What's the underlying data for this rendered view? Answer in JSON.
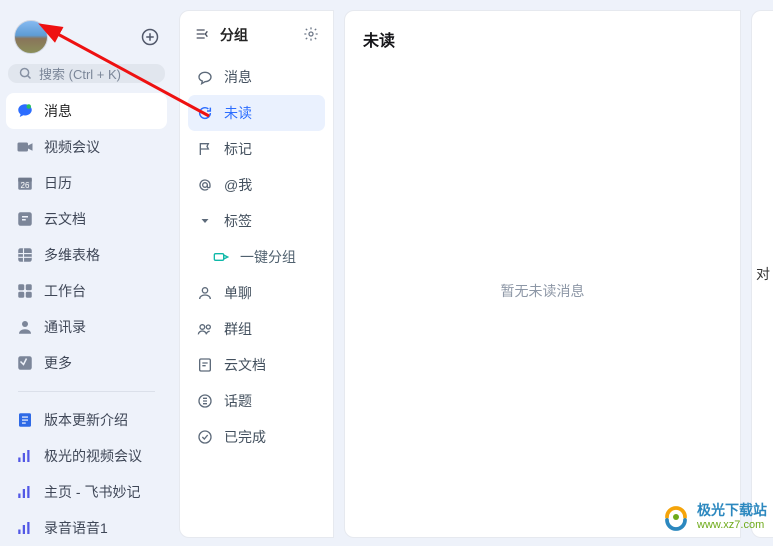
{
  "sidebar": {
    "search_placeholder": "搜索 (Ctrl + K)",
    "nav": [
      {
        "key": "messages",
        "label": "消息"
      },
      {
        "key": "meeting",
        "label": "视频会议"
      },
      {
        "key": "calendar",
        "label": "日历"
      },
      {
        "key": "docs",
        "label": "云文档"
      },
      {
        "key": "bitable",
        "label": "多维表格"
      },
      {
        "key": "workplace",
        "label": "工作台"
      },
      {
        "key": "contacts",
        "label": "通讯录"
      },
      {
        "key": "more",
        "label": "更多"
      }
    ],
    "links": [
      {
        "key": "release",
        "label": "版本更新介绍"
      },
      {
        "key": "jg-meeting",
        "label": "极光的视频会议"
      },
      {
        "key": "home-notes",
        "label": "主页 - 飞书妙记"
      },
      {
        "key": "recording",
        "label": "录音语音1"
      }
    ]
  },
  "mid": {
    "header_title": "分组",
    "items": [
      {
        "key": "msg",
        "label": "消息"
      },
      {
        "key": "unread",
        "label": "未读"
      },
      {
        "key": "flag",
        "label": "标记"
      },
      {
        "key": "atme",
        "label": "@我"
      },
      {
        "key": "tags",
        "label": "标签"
      },
      {
        "key": "onekey",
        "label": "一键分组"
      },
      {
        "key": "single",
        "label": "单聊"
      },
      {
        "key": "group",
        "label": "群组"
      },
      {
        "key": "cloud",
        "label": "云文档"
      },
      {
        "key": "topic",
        "label": "话题"
      },
      {
        "key": "done",
        "label": "已完成"
      }
    ]
  },
  "right": {
    "title": "未读",
    "empty": "暂无未读消息"
  },
  "far_right_hint": "对",
  "watermark": {
    "name": "极光下载站",
    "url": "www.xz7.com"
  },
  "calendar_day": "26"
}
